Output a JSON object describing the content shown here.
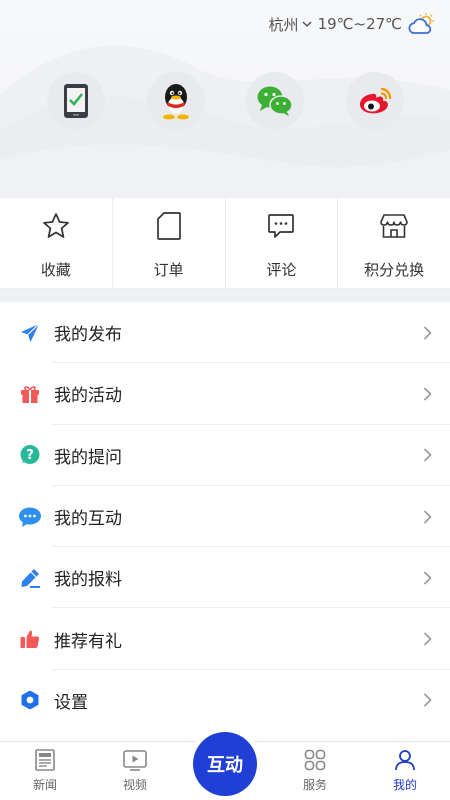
{
  "weather": {
    "city": "杭州",
    "temp": "19℃~27℃"
  },
  "login": [
    "phone-login-icon",
    "qq-login-icon",
    "wechat-login-icon",
    "weibo-login-icon"
  ],
  "quick_actions": [
    {
      "label": "收藏",
      "icon": "star-icon"
    },
    {
      "label": "订单",
      "icon": "order-icon"
    },
    {
      "label": "评论",
      "icon": "comment-icon"
    },
    {
      "label": "积分兑换",
      "icon": "shop-icon"
    }
  ],
  "menu": [
    {
      "label": "我的发布",
      "icon": "send-icon",
      "color": "#2f7ff0"
    },
    {
      "label": "我的活动",
      "icon": "gift-icon",
      "color": "#f25a5a"
    },
    {
      "label": "我的提问",
      "icon": "question-icon",
      "color": "#27b99a"
    },
    {
      "label": "我的互动",
      "icon": "chat-bubble-icon",
      "color": "#2f8ff0"
    },
    {
      "label": "我的报料",
      "icon": "pen-icon",
      "color": "#2f7ff0"
    },
    {
      "label": "推荐有礼",
      "icon": "thumbs-up-icon",
      "color": "#f25a5a"
    },
    {
      "label": "设置",
      "icon": "settings-hex-icon",
      "color": "#1f6fe8"
    }
  ],
  "tabs": [
    {
      "label": "新闻",
      "icon": "news-icon",
      "active": false
    },
    {
      "label": "视频",
      "icon": "video-icon",
      "active": false
    },
    {
      "label": "服务",
      "icon": "grid-icon",
      "active": false
    },
    {
      "label": "我的",
      "icon": "user-icon",
      "active": true
    }
  ],
  "center_button": "互动",
  "colors": {
    "accent": "#1f3fd6",
    "active_tab": "#1e3cc8",
    "divider_band": "#eef1f4"
  }
}
